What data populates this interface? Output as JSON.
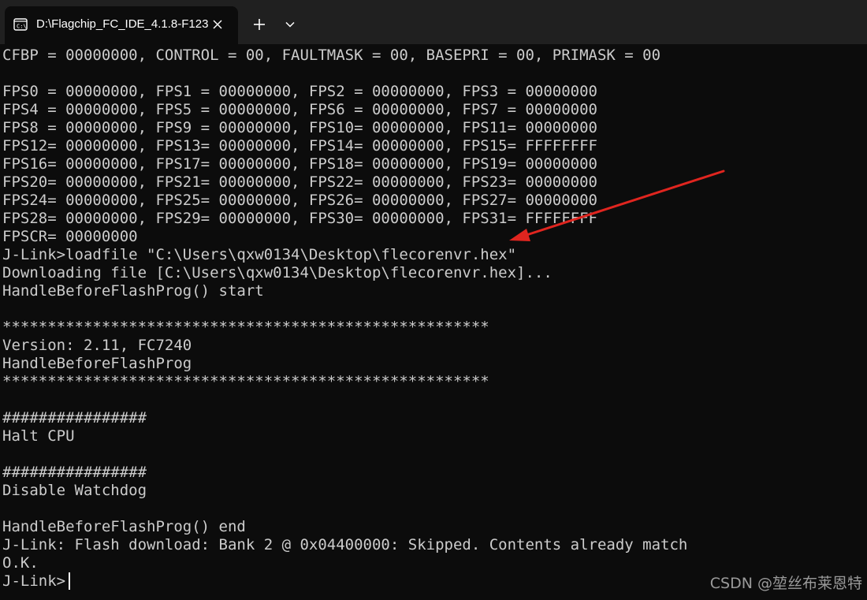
{
  "tab": {
    "title": "D:\\Flagchip_FC_IDE_4.1.8-F123",
    "icon": "terminal-icon"
  },
  "colors": {
    "background": "#0c0c0c",
    "text": "#cccccc",
    "tabbar": "#202020",
    "arrow": "#e0251f"
  },
  "terminal": {
    "lines": [
      "CFBP = 00000000, CONTROL = 00, FAULTMASK = 00, BASEPRI = 00, PRIMASK = 00",
      "",
      "FPS0 = 00000000, FPS1 = 00000000, FPS2 = 00000000, FPS3 = 00000000",
      "FPS4 = 00000000, FPS5 = 00000000, FPS6 = 00000000, FPS7 = 00000000",
      "FPS8 = 00000000, FPS9 = 00000000, FPS10= 00000000, FPS11= 00000000",
      "FPS12= 00000000, FPS13= 00000000, FPS14= 00000000, FPS15= FFFFFFFF",
      "FPS16= 00000000, FPS17= 00000000, FPS18= 00000000, FPS19= 00000000",
      "FPS20= 00000000, FPS21= 00000000, FPS22= 00000000, FPS23= 00000000",
      "FPS24= 00000000, FPS25= 00000000, FPS26= 00000000, FPS27= 00000000",
      "FPS28= 00000000, FPS29= 00000000, FPS30= 00000000, FPS31= FFFFFFFF",
      "FPSCR= 00000000",
      "J-Link>loadfile \"C:\\Users\\qxw0134\\Desktop\\flecorenvr.hex\"",
      "Downloading file [C:\\Users\\qxw0134\\Desktop\\flecorenvr.hex]...",
      "HandleBeforeFlashProg() start",
      "",
      "******************************************************",
      "Version: 2.11, FC7240",
      "HandleBeforeFlashProg",
      "******************************************************",
      "",
      "################",
      "Halt CPU",
      "",
      "################",
      "Disable Watchdog",
      "",
      "HandleBeforeFlashProg() end",
      "J-Link: Flash download: Bank 2 @ 0x04400000: Skipped. Contents already match",
      "O.K.",
      "J-Link>"
    ]
  },
  "watermark": "CSDN @堃丝布莱恩特"
}
